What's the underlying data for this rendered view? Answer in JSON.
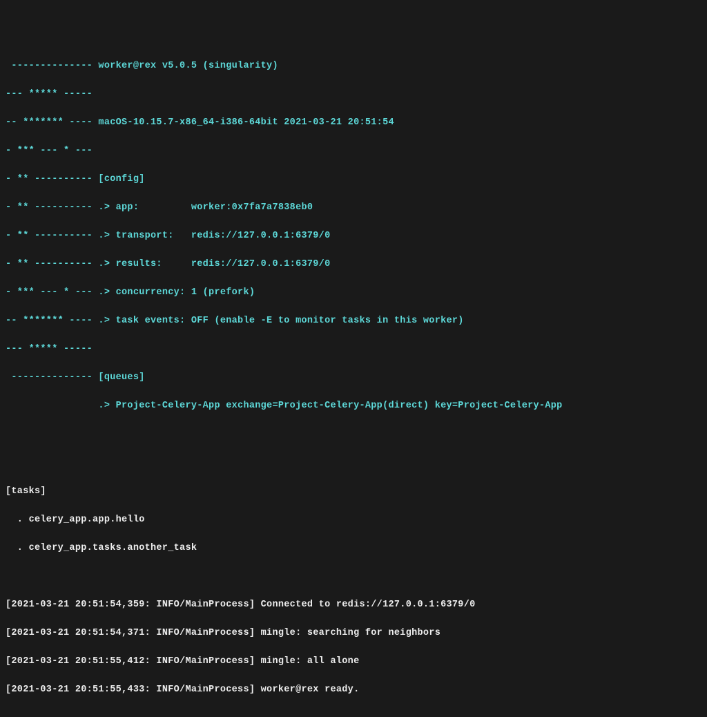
{
  "banner": {
    "l1_art": " -------------- ",
    "l1_text": "worker@rex v5.0.5 (singularity)",
    "l2_art": "--- ***** -----",
    "l3_art": "-- ******* ---- ",
    "l3_text": "macOS-10.15.7-x86_64-i386-64bit 2021-03-21 20:51:54",
    "l4_art": "- *** --- * ---",
    "l5_art": "- ** ---------- ",
    "l5_text": "[config]",
    "l6_art": "- ** ---------- ",
    "l6_text": ".> app:         worker:0x7fa7a7838eb0",
    "l7_art": "- ** ---------- ",
    "l7_text": ".> transport:   redis://127.0.0.1:6379/0",
    "l8_art": "- ** ---------- ",
    "l8_text": ".> results:     redis://127.0.0.1:6379/0",
    "l9_art": "- *** --- * --- ",
    "l9_text": ".> concurrency: 1 (prefork)",
    "l10_art": "-- ******* ---- ",
    "l10_text": ".> task events: OFF (enable -E to monitor tasks in this worker)",
    "l11_art": "--- ***** -----",
    "l12_art": " -------------- ",
    "l12_text": "[queues]",
    "l13_art": "                ",
    "l13_text": ".> Project-Celery-App exchange=Project-Celery-App(direct) key=Project-Celery-App"
  },
  "tasks": {
    "header": "[tasks]",
    "task1": "  . celery_app.app.hello",
    "task2": "  . celery_app.tasks.another_task"
  },
  "logs": {
    "log1": "[2021-03-21 20:51:54,359: INFO/MainProcess] Connected to redis://127.0.0.1:6379/0",
    "log2": "[2021-03-21 20:51:54,371: INFO/MainProcess] mingle: searching for neighbors",
    "log3": "[2021-03-21 20:51:55,412: INFO/MainProcess] mingle: all alone",
    "log4": "[2021-03-21 20:51:55,433: INFO/MainProcess] worker@rex ready."
  }
}
